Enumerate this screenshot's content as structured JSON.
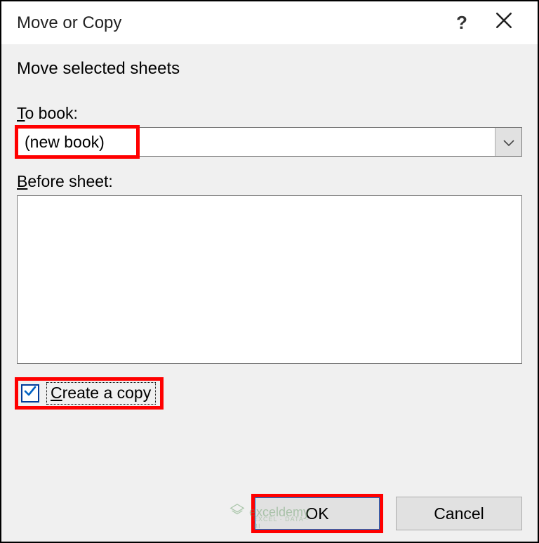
{
  "dialog": {
    "title": "Move or Copy",
    "intro": "Move selected sheets",
    "to_book_label": "To book:",
    "to_book_value": "(new book)",
    "before_sheet_label": "Before sheet:",
    "before_sheet_items": [],
    "create_copy_label": "Create a copy",
    "create_copy_checked": true,
    "ok_label": "OK",
    "cancel_label": "Cancel"
  },
  "watermark": {
    "brand": "exceldemy",
    "tagline": "EXCEL · DATA · BI"
  },
  "icons": {
    "help": "?",
    "close": "close-icon",
    "chevron": "chevron-down-icon",
    "check": "check-icon",
    "logo": "logo-icon"
  },
  "highlights": {
    "to_book_value": true,
    "create_copy": true,
    "ok_button": true
  }
}
